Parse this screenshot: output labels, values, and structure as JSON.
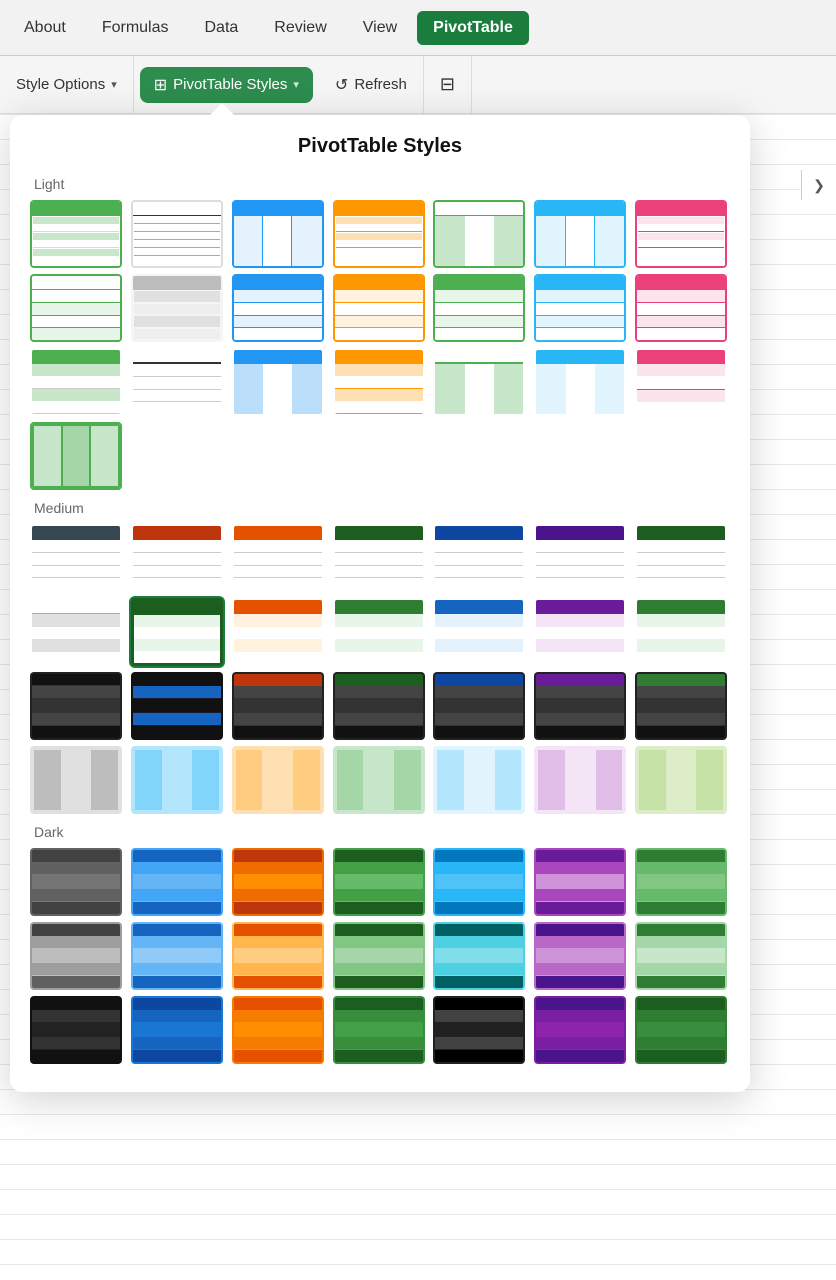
{
  "toolbar": {
    "tabs": [
      {
        "id": "about",
        "label": "About",
        "active": false
      },
      {
        "id": "formulas",
        "label": "Formulas",
        "active": false
      },
      {
        "id": "data",
        "label": "Data",
        "active": false
      },
      {
        "id": "review",
        "label": "Review",
        "active": false
      },
      {
        "id": "view",
        "label": "View",
        "active": false
      },
      {
        "id": "pivottable",
        "label": "PivotTable",
        "active": true
      }
    ]
  },
  "ribbon": {
    "style_options_label": "Style Options",
    "pivot_styles_label": "PivotTable Styles",
    "refresh_label": "Refresh"
  },
  "panel": {
    "title": "PivotTable Styles",
    "sections": [
      {
        "id": "light",
        "label": "Light",
        "styles": [
          {
            "id": "light-1",
            "type": "light",
            "color": "#4caf50",
            "header": "#4caf50",
            "alt": "#c8e6c9",
            "selected": false
          },
          {
            "id": "light-2",
            "type": "light",
            "color": "#999",
            "header": null,
            "alt": null,
            "selected": false
          },
          {
            "id": "light-3",
            "type": "light",
            "color": "#2196f3",
            "header": "#2196f3",
            "alt": "#bbdefb",
            "selected": false
          },
          {
            "id": "light-4",
            "type": "light",
            "color": "#ff9800",
            "header": "#ff9800",
            "alt": "#ffe0b2",
            "selected": false
          },
          {
            "id": "light-5",
            "type": "light",
            "color": "#66bb6a",
            "header": null,
            "alt": "#c8e6c9",
            "selected": false
          },
          {
            "id": "light-6",
            "type": "light",
            "color": "#29b6f6",
            "header": "#29b6f6",
            "alt": "#e1f5fe",
            "selected": false
          },
          {
            "id": "light-7",
            "type": "light",
            "color": "#ec407a",
            "header": "#ec407a",
            "alt": "#fce4ec",
            "selected": false
          },
          {
            "id": "light-8",
            "type": "light-bordered",
            "color": "#4caf50",
            "header": null,
            "alt": null,
            "selected": false
          },
          {
            "id": "light-9",
            "type": "light-bordered",
            "color": "#aaa",
            "header": null,
            "alt": "#f5f5f5",
            "selected": false
          },
          {
            "id": "light-10",
            "type": "light-bordered",
            "color": "#2196f3",
            "header": "#2196f3",
            "alt": "#e3f2fd",
            "selected": false
          },
          {
            "id": "light-11",
            "type": "light-bordered",
            "color": "#ff9800",
            "header": null,
            "alt": "#fff3e0",
            "selected": false
          },
          {
            "id": "light-12",
            "type": "light-bordered",
            "color": "#4caf50",
            "header": null,
            "alt": "#e8f5e9",
            "selected": false
          },
          {
            "id": "light-13",
            "type": "light-bordered",
            "color": "#29b6f6",
            "header": null,
            "alt": "#e1f5fe",
            "selected": false
          },
          {
            "id": "light-14",
            "type": "light-bordered",
            "color": "#ec407a",
            "header": null,
            "alt": "#fce4ec",
            "selected": false
          },
          {
            "id": "light-15",
            "type": "light-striped",
            "color": "#4caf50",
            "header": null,
            "alt": "#c8e6c9",
            "selected": false
          },
          {
            "id": "light-16",
            "type": "light-striped",
            "color": "#aaa",
            "header": null,
            "alt": null,
            "selected": false
          },
          {
            "id": "light-17",
            "type": "light-striped",
            "color": "#2196f3",
            "header": "#2196f3",
            "alt": "#bbdefb",
            "selected": false
          },
          {
            "id": "light-18",
            "type": "light-striped",
            "color": "#ff9800",
            "header": "#ff9800",
            "alt": "#ffe0b2",
            "selected": false
          },
          {
            "id": "light-19",
            "type": "light-striped",
            "color": "#4caf50",
            "header": null,
            "alt": "#c8e6c9",
            "selected": false
          },
          {
            "id": "light-20",
            "type": "light-striped",
            "color": "#29b6f6",
            "header": "#29b6f6",
            "alt": "#e1f5fe",
            "selected": false
          },
          {
            "id": "light-21",
            "type": "light-striped",
            "color": "#ec407a",
            "header": "#ec407a",
            "alt": "#fce4ec",
            "selected": false
          },
          {
            "id": "light-22",
            "type": "light-green-solid",
            "color": "#4caf50",
            "header": "#4caf50",
            "alt": "#a5d6a7",
            "selected": false
          }
        ]
      },
      {
        "id": "medium",
        "label": "Medium",
        "styles": [
          {
            "id": "medium-1",
            "color": "#37474f",
            "header": "#37474f",
            "alt": null
          },
          {
            "id": "medium-2",
            "color": "#bf360c",
            "header": "#bf360c",
            "alt": null
          },
          {
            "id": "medium-3",
            "color": "#e65100",
            "header": "#e65100",
            "alt": null
          },
          {
            "id": "medium-4",
            "color": "#1b5e20",
            "header": "#1b5e20",
            "alt": null
          },
          {
            "id": "medium-5",
            "color": "#0d47a1",
            "header": "#0d47a1",
            "alt": null
          },
          {
            "id": "medium-6",
            "color": "#4a148c",
            "header": "#4a148c",
            "alt": null
          },
          {
            "id": "medium-7",
            "color": "#1b5e20",
            "header": "#1b5e20",
            "alt": null
          },
          {
            "id": "medium-8",
            "color": "#aaa",
            "header": null,
            "alt": "#f5f5f5"
          },
          {
            "id": "medium-9",
            "color": "#1565c0",
            "header": "#1565c0",
            "alt": "#e3f2fd",
            "selected": true
          },
          {
            "id": "medium-10",
            "color": "#e65100",
            "header": "#e65100",
            "alt": "#fff3e0"
          },
          {
            "id": "medium-11",
            "color": "#2e7d32",
            "header": "#2e7d32",
            "alt": "#e8f5e9"
          },
          {
            "id": "medium-12",
            "color": "#1565c0",
            "header": "#1565c0",
            "alt": "#e3f2fd"
          },
          {
            "id": "medium-13",
            "color": "#6a1b9a",
            "header": "#6a1b9a",
            "alt": "#f3e5f5"
          },
          {
            "id": "medium-14",
            "color": "#2e7d32",
            "header": "#2e7d32",
            "alt": "#e8f5e9"
          },
          {
            "id": "medium-15",
            "color": "#222",
            "header": "#222",
            "alt": "#555"
          },
          {
            "id": "medium-16",
            "color": "#111",
            "header": "#111",
            "alt": "#1565c0"
          },
          {
            "id": "medium-17",
            "color": "#222",
            "header": "#bf360c",
            "alt": "#555"
          },
          {
            "id": "medium-18",
            "color": "#222",
            "header": "#1b5e20",
            "alt": "#555"
          },
          {
            "id": "medium-19",
            "color": "#222",
            "header": "#0d47a1",
            "alt": "#555"
          },
          {
            "id": "medium-20",
            "color": "#222",
            "header": "#6a1b9a",
            "alt": "#555"
          },
          {
            "id": "medium-21",
            "color": "#222",
            "header": "#2e7d32",
            "alt": "#555"
          },
          {
            "id": "medium-22",
            "color": "#aaa",
            "header": null,
            "alt": "#e0e0e0"
          },
          {
            "id": "medium-23",
            "color": "#29b6f6",
            "header": null,
            "alt": "#b3e5fc"
          },
          {
            "id": "medium-24",
            "color": "#ff9800",
            "header": null,
            "alt": "#ffe0b2"
          },
          {
            "id": "medium-25",
            "color": "#66bb6a",
            "header": null,
            "alt": "#c8e6c9"
          },
          {
            "id": "medium-26",
            "color": "#29b6f6",
            "header": null,
            "alt": "#e1f5fe"
          },
          {
            "id": "medium-27",
            "color": "#ab47bc",
            "header": null,
            "alt": "#f3e5f5"
          },
          {
            "id": "medium-28",
            "color": "#9ccc65",
            "header": null,
            "alt": "#dcedc8"
          }
        ]
      },
      {
        "id": "dark",
        "label": "Dark",
        "styles": [
          {
            "id": "dark-1",
            "color": "#424242",
            "header": "#424242",
            "body": "#757575"
          },
          {
            "id": "dark-2",
            "color": "#1565c0",
            "header": "#1565c0",
            "body": "#42a5f5"
          },
          {
            "id": "dark-3",
            "color": "#bf360c",
            "header": "#bf360c",
            "body": "#ef6c00"
          },
          {
            "id": "dark-4",
            "color": "#1b5e20",
            "header": "#1b5e20",
            "body": "#43a047"
          },
          {
            "id": "dark-5",
            "color": "#0277bd",
            "header": "#0277bd",
            "body": "#29b6f6"
          },
          {
            "id": "dark-6",
            "color": "#6a1b9a",
            "header": "#6a1b9a",
            "body": "#ab47bc"
          },
          {
            "id": "dark-7",
            "color": "#2e7d32",
            "header": "#2e7d32",
            "body": "#66bb6a"
          },
          {
            "id": "dark-8",
            "color": "#424242",
            "header": "#424242",
            "body": "#9e9e9e"
          },
          {
            "id": "dark-9",
            "color": "#1565c0",
            "header": "#1565c0",
            "body": "#64b5f6"
          },
          {
            "id": "dark-10",
            "color": "#e65100",
            "header": "#e65100",
            "body": "#ffb74d"
          },
          {
            "id": "dark-11",
            "color": "#1b5e20",
            "header": "#1b5e20",
            "body": "#81c784"
          },
          {
            "id": "dark-12",
            "color": "#006064",
            "header": "#006064",
            "body": "#4dd0e1"
          },
          {
            "id": "dark-13",
            "color": "#4a148c",
            "header": "#4a148c",
            "body": "#ba68c8"
          },
          {
            "id": "dark-14",
            "color": "#2e7d32",
            "header": "#2e7d32",
            "body": "#a5d6a7"
          },
          {
            "id": "dark-15",
            "color": "#111",
            "header": "#111",
            "body": "#333"
          },
          {
            "id": "dark-16",
            "color": "#0d47a1",
            "header": "#0d47a1",
            "body": "#1976d2"
          },
          {
            "id": "dark-17",
            "color": "#e65100",
            "header": "#e65100",
            "body": "#f57c00"
          },
          {
            "id": "dark-18",
            "color": "#1b5e20",
            "header": "#1b5e20",
            "body": "#388e3c"
          },
          {
            "id": "dark-19",
            "color": "#000",
            "header": "#000",
            "body": "#212121"
          },
          {
            "id": "dark-20",
            "color": "#4a148c",
            "header": "#4a148c",
            "body": "#7b1fa2"
          },
          {
            "id": "dark-21",
            "color": "#1b5e20",
            "header": "#1b5e20",
            "body": "#2e7d32"
          }
        ]
      }
    ]
  }
}
